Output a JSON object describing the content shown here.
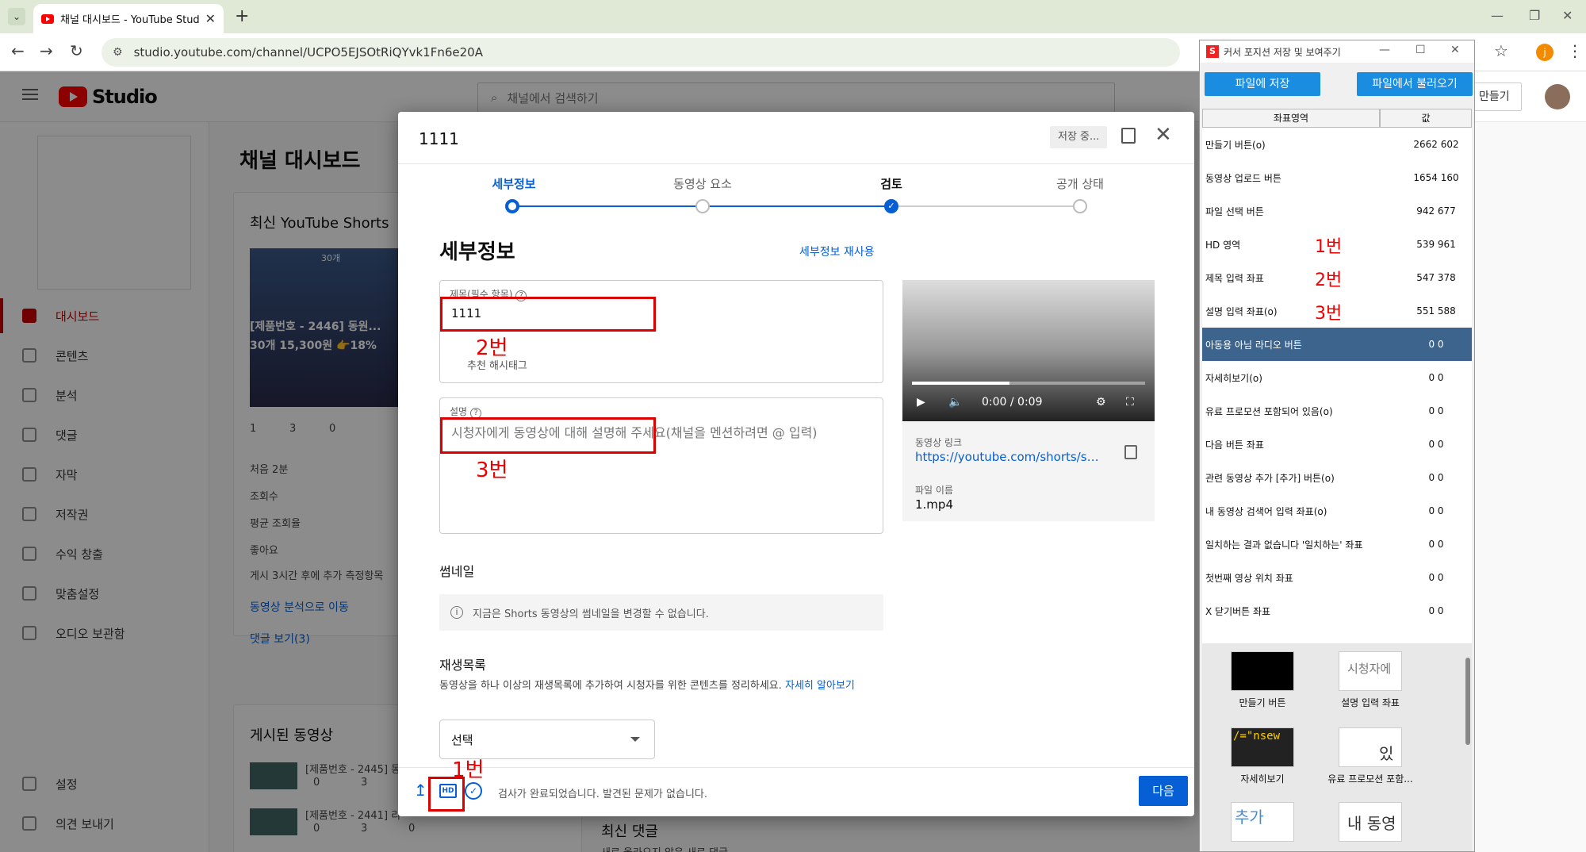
{
  "browser": {
    "tab_title": "채널 대시보드 - YouTube Studio",
    "url": "studio.youtube.com/channel/UCPO5EJSOtRiQYvk1Fn6e20A",
    "profile_initial": "j"
  },
  "studio": {
    "logo": "Studio",
    "search_placeholder": "채널에서 검색하기",
    "create_label": "만들기",
    "sidebar": [
      {
        "label": "대시보드",
        "active": true
      },
      {
        "label": "콘텐츠"
      },
      {
        "label": "분석"
      },
      {
        "label": "댓글"
      },
      {
        "label": "자막"
      },
      {
        "label": "저작권"
      },
      {
        "label": "수익 창출"
      },
      {
        "label": "맞춤설정"
      },
      {
        "label": "오디오 보관함"
      }
    ],
    "sidebar_bottom": [
      {
        "label": "설정"
      },
      {
        "label": "의견 보내기"
      }
    ],
    "dashboard_title": "채널 대시보드",
    "shorts_card": {
      "title": "최신 YouTube Shorts",
      "thumb_badge": "30개",
      "thumb_line1": "[제품번호 - 2446] 동원...",
      "thumb_line2": "30개 15,300원 👉18%",
      "stats": [
        "1",
        "3",
        "0"
      ],
      "first_period": "처음 2분",
      "rows": [
        "조회수",
        "평균 조회율",
        "좋아요"
      ],
      "note": "게시 3시간 후에 추가 측정항목",
      "link1": "동영상 분석으로 이동",
      "link2": "댓글 보기(3)"
    },
    "published_card": {
      "title": "게시된 동영상",
      "rows": [
        {
          "title": "[제품번호 - 2445] 동",
          "views": "0",
          "comments": "3"
        },
        {
          "title": "[제품번호 - 2441] 리",
          "views": "0",
          "comments": "3",
          "likes": "0"
        }
      ]
    },
    "latest_comments_title": "최신 댓글",
    "latest_comments_sub": "새로 올라오지 않은 새로 댓글"
  },
  "modal": {
    "title": "1111",
    "saving": "저장 중...",
    "steps": [
      "세부정보",
      "동영상 요소",
      "검토",
      "공개 상태"
    ],
    "section_title": "세부정보",
    "reuse_link": "세부정보 재사용",
    "title_field": {
      "label": "제목(필수 항목)",
      "value": "1111",
      "hashtag": "추천 해시태그"
    },
    "desc_field": {
      "label": "설명",
      "placeholder": "시청자에게 동영상에 대해 설명해 주세요(채널을 멘션하려면 @ 입력)"
    },
    "thumbnail_title": "썸네일",
    "thumbnail_info": "지금은 Shorts 동영상의 썸네일을 변경할 수 없습니다.",
    "playlist_title": "재생목록",
    "playlist_desc": "동영상을 하나 이상의 재생목록에 추가하여 시청자를 위한 콘텐츠를 정리하세요.",
    "playlist_learn": "자세히 알아보기",
    "playlist_select": "선택",
    "preview": {
      "time": "0:00 / 0:09",
      "progress": 0.42,
      "link_label": "동영상 링크",
      "link": "https://youtube.com/shorts/s7...",
      "file_label": "파일 이름",
      "file_name": "1.mp4"
    },
    "footer_status": "검사가 완료되었습니다. 발견된 문제가 없습니다.",
    "hd_label": "HD",
    "next_label": "다음"
  },
  "annotations": {
    "label1": "1번",
    "label2": "2번",
    "label3": "3번"
  },
  "tool": {
    "title": "커서 포지션 저장 및 보여주기",
    "save_btn": "파일에 저장",
    "load_btn": "파일에서 불러오기",
    "col_area": "좌표영역",
    "col_value": "값",
    "rows": [
      {
        "name": "만들기 버튼(o)",
        "value": "2662 602"
      },
      {
        "name": "동영상 업로드 버튼",
        "value": "1654 160"
      },
      {
        "name": "파일 선택 버튼",
        "value": "942 677"
      },
      {
        "name": "HD 영역",
        "value": "539 961",
        "tag": "1번"
      },
      {
        "name": "제목 입력 좌표",
        "value": "547 378",
        "tag": "2번"
      },
      {
        "name": "설명 입력 좌표(o)",
        "value": "551 588",
        "tag": "3번"
      },
      {
        "name": "아동용 아님 라디오 버튼",
        "value": "0 0",
        "selected": true
      },
      {
        "name": "자세히보기(o)",
        "value": "0 0"
      },
      {
        "name": "유료 프로모션 포함되어 있음(o)",
        "value": "0 0"
      },
      {
        "name": "다음 버튼 좌표",
        "value": "0 0"
      },
      {
        "name": "관련 동영상 추가 [추가] 버튼(o)",
        "value": "0 0"
      },
      {
        "name": "내 동영상 검색어 입력 좌표(o)",
        "value": "0 0"
      },
      {
        "name": "일치하는 결과 없습니다 '일치하는' 좌표",
        "value": "0 0"
      },
      {
        "name": "첫번째 영상 위치 좌표",
        "value": "0 0"
      },
      {
        "name": "X 닫기버튼 좌표",
        "value": "0 0"
      }
    ],
    "thumbs": [
      {
        "caption": "만들기 버튼",
        "text": ""
      },
      {
        "caption": "설명 입력 좌표",
        "text": "시청자에"
      },
      {
        "caption": "자세히보기",
        "text": "/=\"nsew"
      },
      {
        "caption": "유료 프로모션 포함...",
        "text": "있"
      },
      {
        "caption": "",
        "text": "추가"
      },
      {
        "caption": "",
        "text": "내 동영"
      }
    ]
  }
}
